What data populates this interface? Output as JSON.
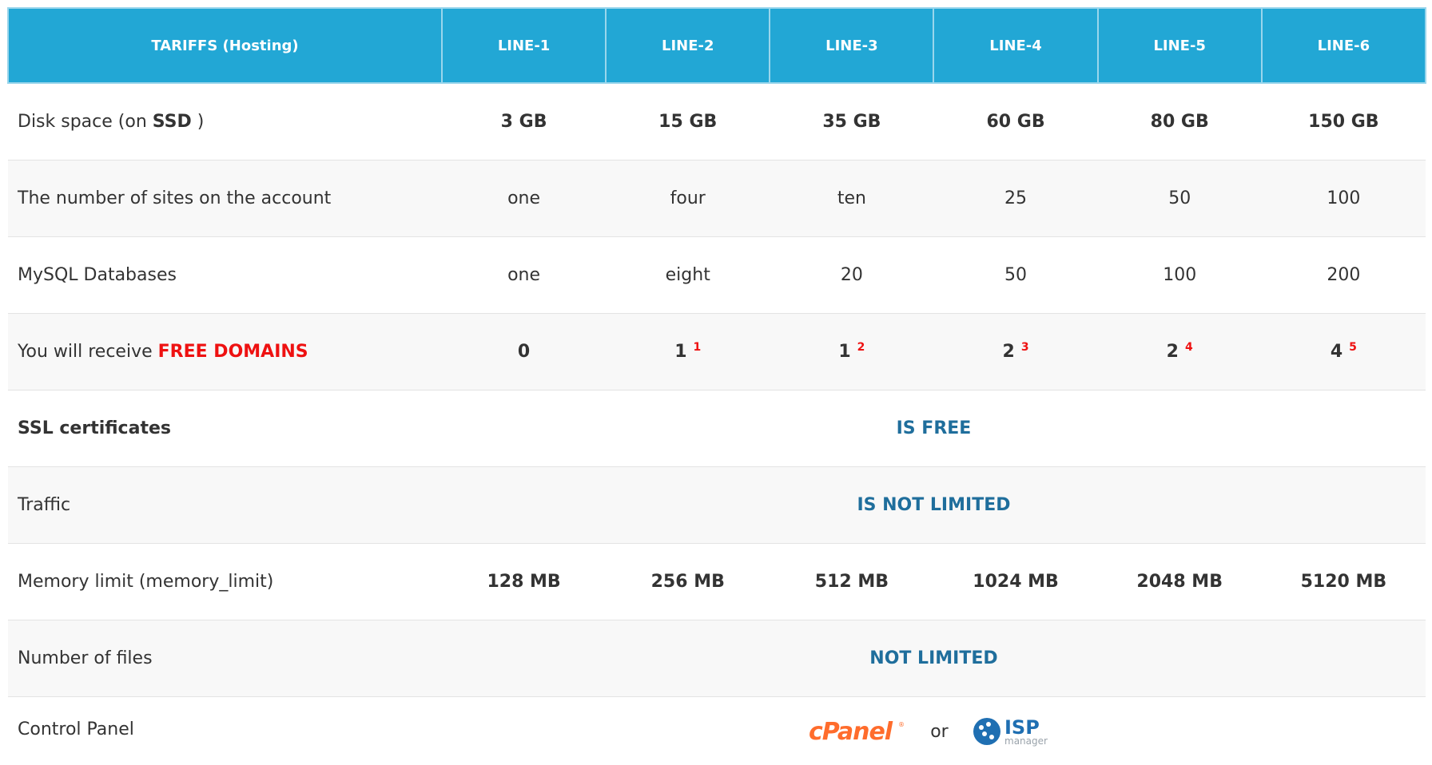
{
  "header": {
    "first": "TARIFFS (Hosting)",
    "plans": [
      "LINE-1",
      "LINE-2",
      "LINE-3",
      "LINE-4",
      "LINE-5",
      "LINE-6"
    ]
  },
  "rows": {
    "disk": {
      "label_prefix": "Disk space (on ",
      "label_strong": "SSD",
      "label_suffix": " )",
      "values": [
        "3 GB",
        "15 GB",
        "35 GB",
        "60 GB",
        "80 GB",
        "150 GB"
      ]
    },
    "sites": {
      "label": "The number of sites on the account",
      "values": [
        "one",
        "four",
        "ten",
        "25",
        "50",
        "100"
      ]
    },
    "mysql": {
      "label": "MySQL Databases",
      "values": [
        "one",
        "eight",
        "20",
        "50",
        "100",
        "200"
      ]
    },
    "domains": {
      "label_prefix": "You will receive ",
      "label_highlight": "FREE DOMAINS",
      "values": [
        "0",
        "1",
        "1",
        "2",
        "2",
        "4"
      ],
      "footnotes": [
        "",
        "1",
        "2",
        "3",
        "4",
        "5"
      ]
    },
    "ssl": {
      "label": "SSL certificates",
      "value": "IS FREE"
    },
    "traffic": {
      "label": "Traffic",
      "value": "IS NOT LIMITED"
    },
    "memory": {
      "label": "Memory limit (memory_limit)",
      "values": [
        "128 MB",
        "256 MB",
        "512 MB",
        "1024 MB",
        "2048 MB",
        "5120 MB"
      ]
    },
    "files": {
      "label": "Number of files",
      "value": "NOT LIMITED"
    },
    "panel": {
      "label": "Control Panel",
      "cpanel_text": "cPanel",
      "or_text": "or",
      "isp_text": "ISP",
      "isp_subtext": "manager"
    }
  },
  "colors": {
    "header_bg": "#22a7d5",
    "accent_blue": "#1f6e9c",
    "highlight_red": "#ee1111",
    "cpanel_orange": "#ff6c2c",
    "isp_blue": "#1f6fb2"
  },
  "icons": {
    "cpanel": "cpanel-logo-icon",
    "isp": "ispmanager-logo-icon"
  }
}
